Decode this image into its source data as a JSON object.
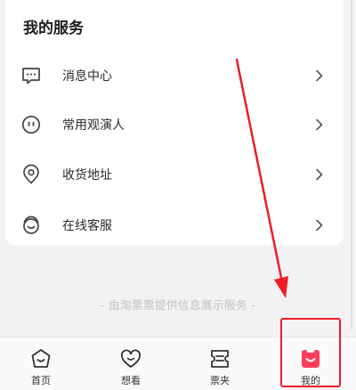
{
  "services": {
    "title": "我的服务",
    "items": [
      {
        "label": "消息中心",
        "icon": "message-icon"
      },
      {
        "label": "常用观演人",
        "icon": "face-icon"
      },
      {
        "label": "收货地址",
        "icon": "location-pin-icon"
      },
      {
        "label": "在线客服",
        "icon": "customer-service-icon"
      }
    ]
  },
  "footer_note": "- 由淘票票提供信息展示服务 -",
  "tabbar": {
    "tabs": [
      {
        "label": "首页",
        "icon": "home-icon",
        "active": false
      },
      {
        "label": "想看",
        "icon": "heart-icon",
        "active": false
      },
      {
        "label": "票夹",
        "icon": "ticket-icon",
        "active": false
      },
      {
        "label": "我的",
        "icon": "profile-icon",
        "active": true
      }
    ]
  },
  "colors": {
    "accent": "#ff3c5a",
    "annotation_red": "#ee1c25",
    "icon_gray": "#444444"
  }
}
